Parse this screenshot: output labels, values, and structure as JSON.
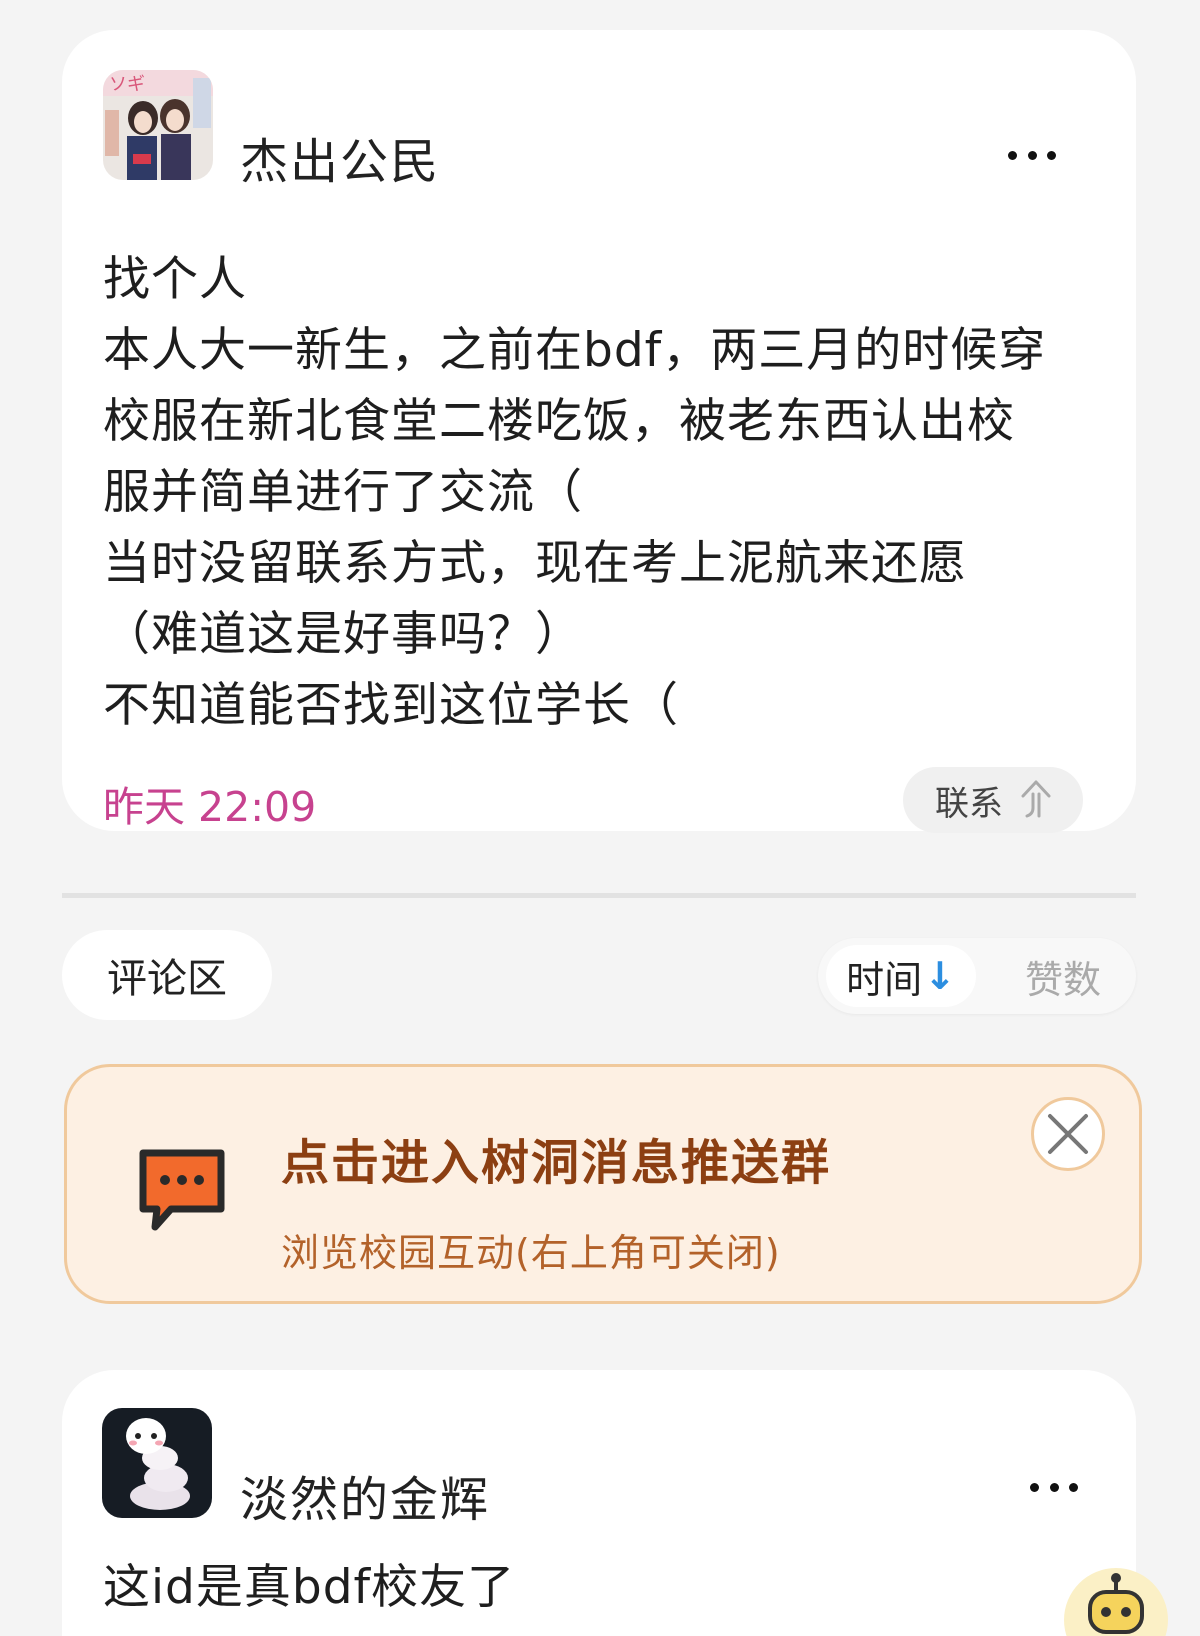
{
  "post": {
    "username": "杰出公民",
    "lines": [
      "找个人",
      "本人大一新生，之前在bdf，两三月的时候穿",
      "校服在新北食堂二楼吃饭，被老东西认出校",
      "服并简单进行了交流（",
      "当时没留联系方式，现在考上泥航来还愿",
      "（难道这是好事吗？）",
      "不知道能否找到这位学长（"
    ],
    "timestamp": "昨天 22:09",
    "contact_label": "联系"
  },
  "comments_header": {
    "title": "评论区",
    "sort_time": "时间",
    "sort_time_arrow": "↓",
    "sort_likes": "赞数"
  },
  "banner": {
    "title": "点击进入树洞消息推送群",
    "subtitle": "浏览校园互动(右上角可关闭)"
  },
  "comments": [
    {
      "username": "淡然的金辉",
      "text": "这id是真bdf校友了"
    }
  ],
  "colors": {
    "timestamp": "#c7428f",
    "banner_bg": "#fdf0e3",
    "banner_border": "#f0c99c",
    "banner_title": "#8c3f12",
    "sort_arrow": "#2c8ee0"
  }
}
